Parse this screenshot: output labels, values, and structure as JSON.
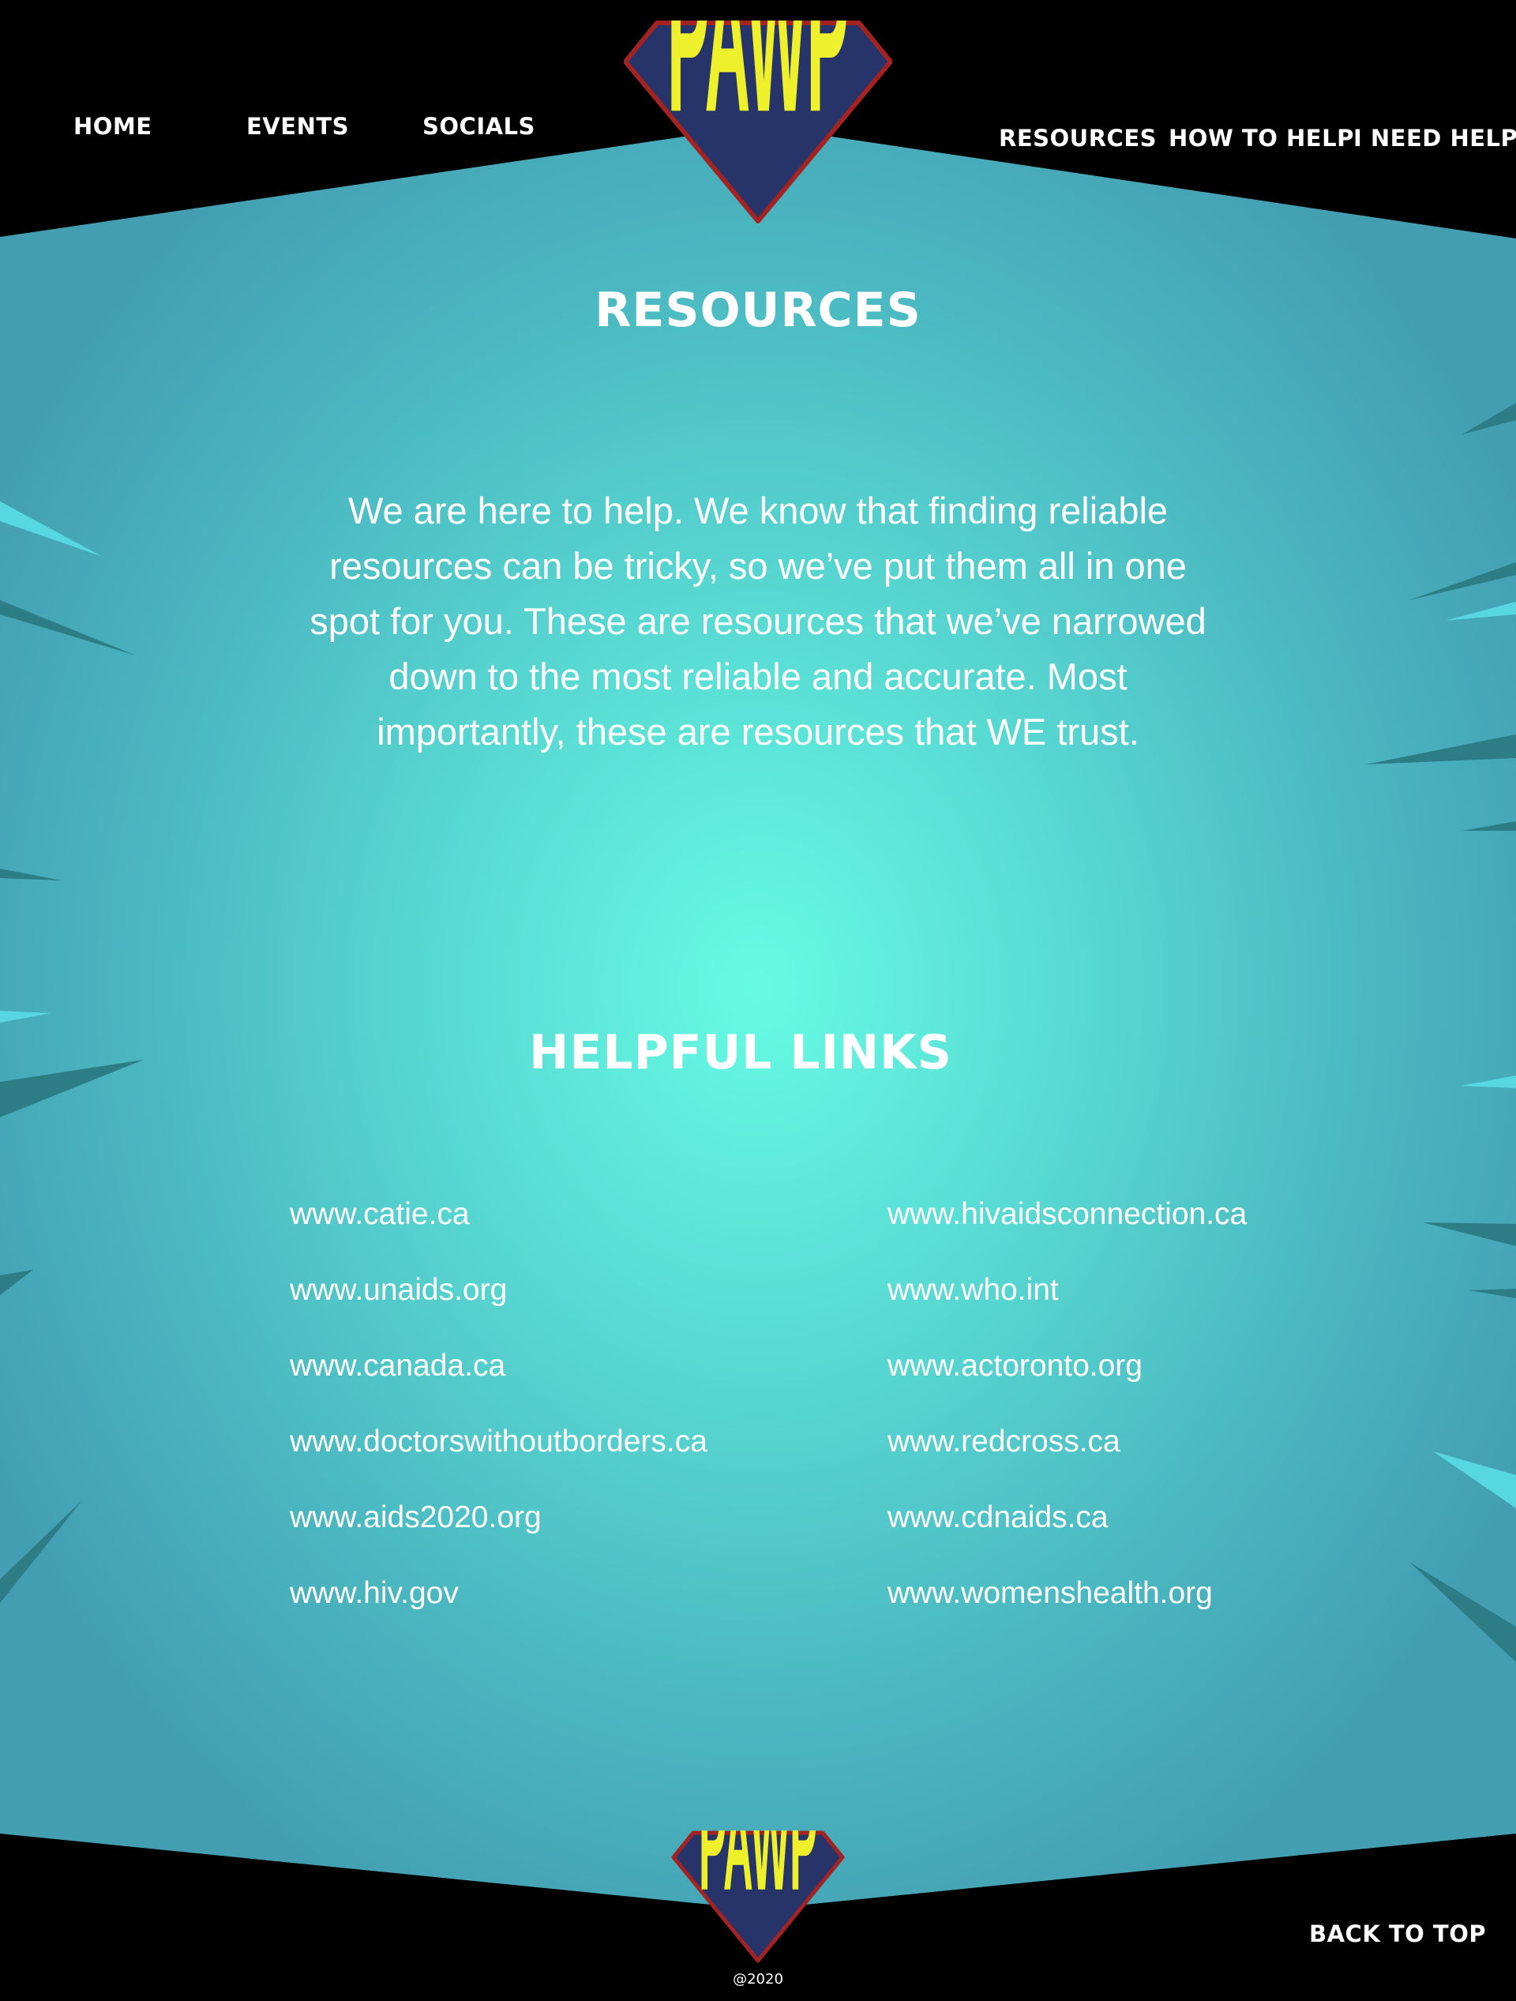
{
  "nav": {
    "left": [
      "HOME",
      "EVENTS",
      "SOCIALS"
    ],
    "right": [
      "RESOURCES",
      "HOW TO HELP",
      "I NEED HELP"
    ]
  },
  "logo": {
    "text": "PAWP"
  },
  "main": {
    "title": "RESOURCES",
    "intro": "We are here to help. We know that finding reliable resources can be tricky, so we’ve put them all in one spot for you. These are resources that we’ve narrowed down to the most reliable and accurate. Most importantly, these are resources that WE trust.",
    "links_title": "HELPFUL LINKS",
    "links_left": [
      "www.catie.ca",
      "www.unaids.org",
      "www.canada.ca",
      "www.doctorswithoutborders.ca",
      "www.aids2020.org",
      "www.hiv.gov"
    ],
    "links_right": [
      "www.hivaidsconnection.ca",
      "www.who.int",
      "www.actoronto.org",
      "www.redcross.ca",
      "www.cdnaids.ca",
      "www.womenshealth.org"
    ]
  },
  "footer": {
    "back_to_top": "BACK TO TOP",
    "copyright": "@2020"
  },
  "colors": {
    "header_bg": "#000000",
    "logo_fill": "#eef02b",
    "logo_shield": "#26346a",
    "logo_border": "#a32222",
    "text": "#ffffff",
    "bg_center": "#66fbe4",
    "bg_edge": "#439eb2"
  }
}
